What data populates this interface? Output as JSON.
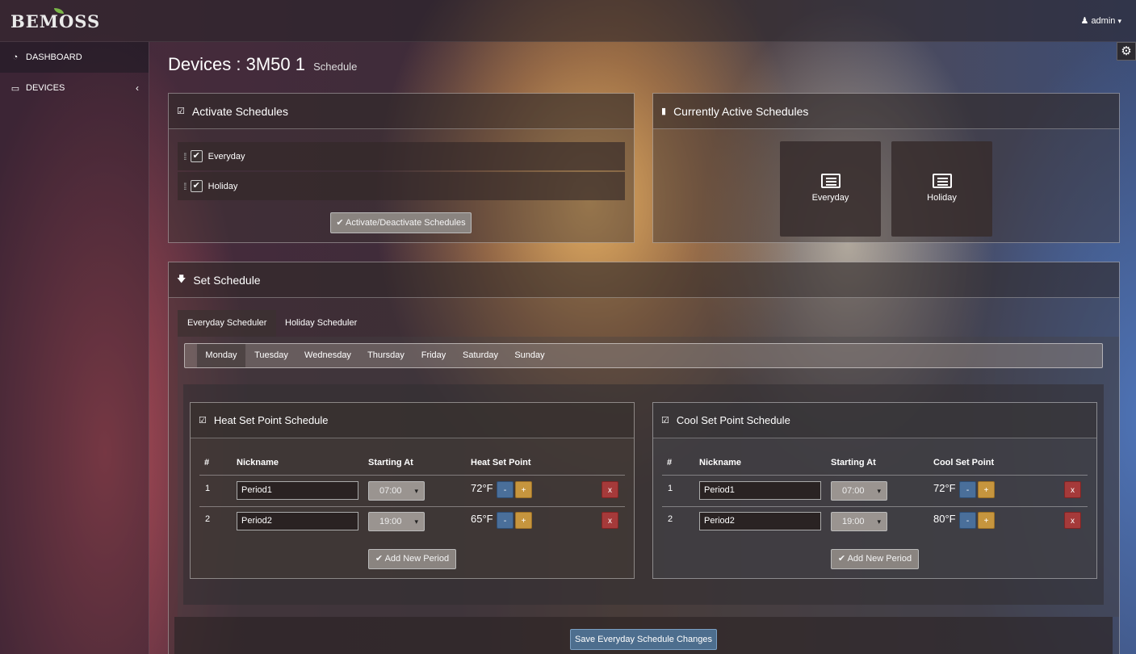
{
  "app": {
    "logo": "BEMOSS"
  },
  "user_menu": {
    "label": "admin",
    "caret": "▾",
    "icon": "person-icon"
  },
  "sidebar": {
    "items": [
      {
        "label": "DASHBOARD",
        "icon": "dashboard-icon"
      },
      {
        "label": "DEVICES",
        "icon": "monitor-icon",
        "chevron": "‹"
      }
    ]
  },
  "page": {
    "title": "Devices : 3M50 1",
    "subtitle": "Schedule"
  },
  "activate_panel": {
    "title": "Activate Schedules",
    "schedules": [
      {
        "label": "Everyday",
        "checked": true
      },
      {
        "label": "Holiday",
        "checked": true
      }
    ],
    "button_label": "Activate/Deactivate Schedules"
  },
  "active_panel": {
    "title": "Currently Active Schedules",
    "tiles": [
      {
        "label": "Everyday"
      },
      {
        "label": "Holiday"
      }
    ]
  },
  "set_schedule": {
    "title": "Set Schedule",
    "tabs": [
      {
        "label": "Everyday Scheduler"
      },
      {
        "label": "Holiday Scheduler"
      }
    ],
    "days": [
      {
        "label": "Monday"
      },
      {
        "label": "Tuesday"
      },
      {
        "label": "Wednesday"
      },
      {
        "label": "Thursday"
      },
      {
        "label": "Friday"
      },
      {
        "label": "Saturday"
      },
      {
        "label": "Sunday"
      }
    ],
    "selected_day": "Monday",
    "heat": {
      "title": "Heat Set Point Schedule",
      "columns": {
        "num": "#",
        "nickname": "Nickname",
        "start": "Starting At",
        "setpoint": "Heat Set Point"
      },
      "rows": [
        {
          "num": "1",
          "nickname": "Period1",
          "start": "07:00",
          "setpoint": "72°F"
        },
        {
          "num": "2",
          "nickname": "Period2",
          "start": "19:00",
          "setpoint": "65°F"
        }
      ],
      "add_label": "Add New Period"
    },
    "cool": {
      "title": "Cool Set Point Schedule",
      "columns": {
        "num": "#",
        "nickname": "Nickname",
        "start": "Starting At",
        "setpoint": "Cool Set Point"
      },
      "rows": [
        {
          "num": "1",
          "nickname": "Period1",
          "start": "07:00",
          "setpoint": "72°F"
        },
        {
          "num": "2",
          "nickname": "Period2",
          "start": "19:00",
          "setpoint": "80°F"
        }
      ],
      "add_label": "Add New Period"
    },
    "controls": {
      "minus": "-",
      "plus": "+",
      "delete": "x",
      "check": "✔",
      "arrow": "▾"
    },
    "save_label": "Save Everyday Schedule Changes"
  },
  "colors": {
    "save": "#4d6e8e",
    "plus": "#c6953e",
    "minus": "#4a6f9a",
    "delete": "#a53a3a"
  }
}
